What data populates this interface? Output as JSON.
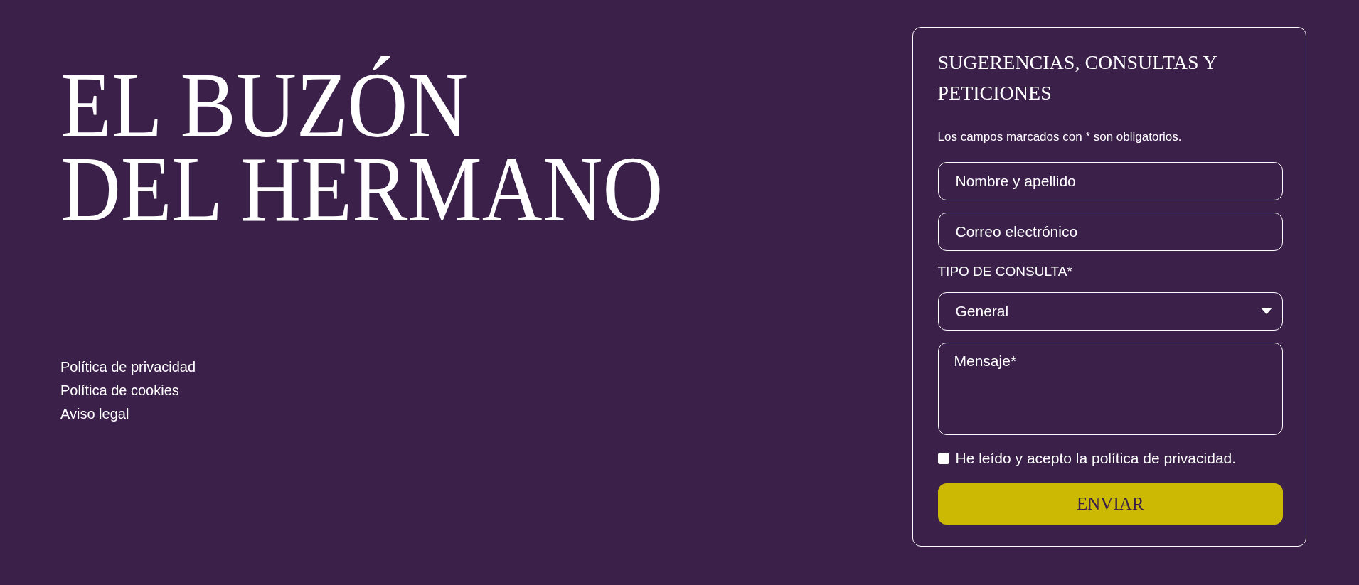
{
  "title": {
    "lines": [
      "EL BUZÓN",
      "DEL HERMANO"
    ]
  },
  "footer_links": [
    "Política de privacidad",
    "Política de cookies",
    "Aviso legal"
  ],
  "form": {
    "heading": "SUGERENCIAS, CONSULTAS Y PETICIONES",
    "note": "Los campos marcados con * son obligatorios.",
    "fields": [
      {
        "kind": "text",
        "placeholder": "Nombre y apellido"
      },
      {
        "kind": "text",
        "placeholder": "Correo electrónico"
      },
      {
        "kind": "label",
        "text": "TIPO DE CONSULTA*"
      },
      {
        "kind": "select",
        "value": "General"
      },
      {
        "kind": "textarea",
        "placeholder": "Mensaje*"
      }
    ],
    "consent": {
      "label": "He leído y acepto la política de privacidad.",
      "checked": false
    },
    "submit": "ENVIAR"
  }
}
